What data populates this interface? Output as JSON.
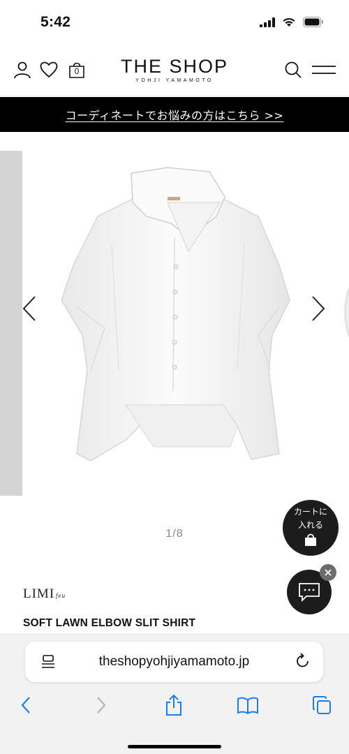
{
  "status_bar": {
    "time": "5:42"
  },
  "header": {
    "logo_title": "THE SHOP",
    "logo_subtitle": "YOHJI YAMAMOTO",
    "cart_count": "0",
    "icons": [
      "user-icon",
      "heart-icon",
      "bag-icon",
      "search-icon",
      "menu-icon"
    ]
  },
  "banner": {
    "text": "コーディネートでお悩みの方はこちら >>"
  },
  "gallery": {
    "counter": "1/8"
  },
  "floating": {
    "cart_line1": "カートに",
    "cart_line2": "入れる"
  },
  "product": {
    "brand": "LIMI",
    "brand_suffix": "feu",
    "title": "SOFT LAWN ELBOW SLIT SHIRT"
  },
  "browser": {
    "url": "theshopyohjiyamamoto.jp",
    "toolbar_icons": [
      "back-icon",
      "forward-icon",
      "share-icon",
      "bookmarks-icon",
      "tabs-icon"
    ]
  },
  "colors": {
    "banner_bg": "#000000",
    "fab_bg": "#1c1c1c",
    "link_blue": "#1a7cf5"
  }
}
